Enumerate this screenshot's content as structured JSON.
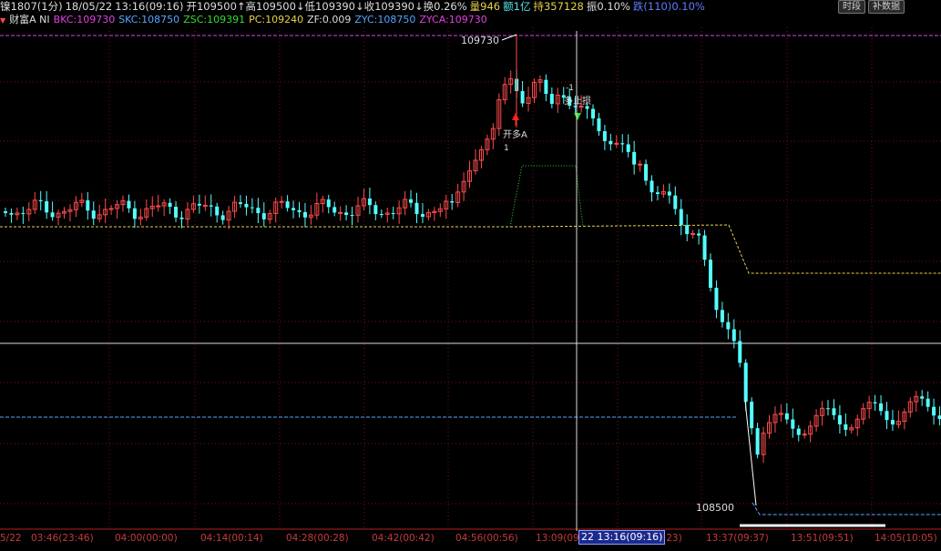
{
  "header": {
    "items": [
      {
        "text": "镍1807(1分)",
        "color": "#dddddd"
      },
      {
        "text": "18/05/22",
        "color": "#dddddd"
      },
      {
        "text": "13:16(09:16)",
        "color": "#dddddd"
      },
      {
        "text": "开109500↑高109500↓低109390↓收109390↓换0.26%",
        "color": "#dddddd"
      },
      {
        "text": "量946",
        "color": "#e6d24a"
      },
      {
        "text": "额1亿",
        "color": "#4fe0e8"
      },
      {
        "text": "持357128",
        "color": "#e6d24a"
      },
      {
        "text": "振0.10%",
        "color": "#dddddd"
      },
      {
        "text": "跌(110)0.10%",
        "color": "#5f7dff"
      }
    ],
    "btn_period": "时段",
    "btn_data": "补数据"
  },
  "indicator": {
    "arrow": "▼",
    "name": "财富A NI",
    "values": [
      {
        "text": "BKC:109730",
        "color": "#e040e0"
      },
      {
        "text": "SKC:108750",
        "color": "#55a6ff"
      },
      {
        "text": "ZSC:109391",
        "color": "#33dd33"
      },
      {
        "text": "PC:109240",
        "color": "#e6d24a"
      },
      {
        "text": "ZF:0.009",
        "color": "#dddddd"
      },
      {
        "text": "ZYC:108750",
        "color": "#55a6ff"
      },
      {
        "text": "ZYCA:109730",
        "color": "#e040e0"
      }
    ]
  },
  "chart_labels": {
    "high_price": "109730",
    "low_price": "108500",
    "signal_open": "开多A",
    "signal_stop": "多止损",
    "signal_num_up": "1",
    "signal_num_down": "-1"
  },
  "axis": {
    "labels": [
      "5/22",
      "03:46(23:46)",
      "04:00(00:00)",
      "04:14(00:14)",
      "04:28(00:28)",
      "04:42(00:42)",
      "04:56(00:56)",
      "13:09(09:09)",
      "13:23(09:23)",
      "13:37(09:37)",
      "13:51(09:51)",
      "14:05(10:05)"
    ],
    "cursor_label": "22 13:16(09:16)"
  },
  "colors": {
    "up": "#ff4b4b",
    "down": "#54ffff",
    "grid": "#7a1010"
  }
}
